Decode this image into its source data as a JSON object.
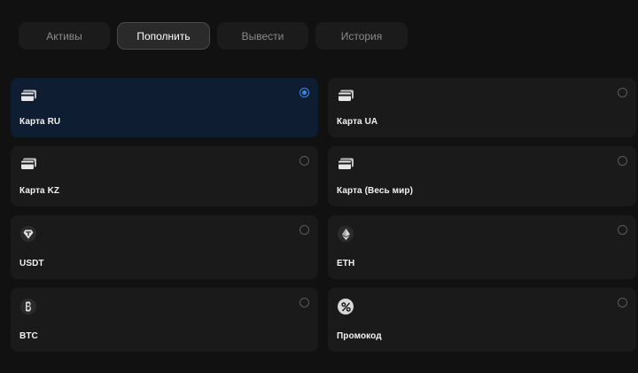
{
  "tabs": [
    {
      "label": "Активы",
      "active": false
    },
    {
      "label": "Пополнить",
      "active": true
    },
    {
      "label": "Вывести",
      "active": false
    },
    {
      "label": "История",
      "active": false
    }
  ],
  "methods": [
    {
      "label": "Карта RU",
      "icon": "card-icon",
      "selected": true
    },
    {
      "label": "Карта UA",
      "icon": "card-icon",
      "selected": false
    },
    {
      "label": "Карта KZ",
      "icon": "card-icon",
      "selected": false
    },
    {
      "label": "Карта (Весь мир)",
      "icon": "card-icon",
      "selected": false
    },
    {
      "label": "USDT",
      "icon": "usdt-icon",
      "selected": false
    },
    {
      "label": "ETH",
      "icon": "eth-icon",
      "selected": false
    },
    {
      "label": "BTC",
      "icon": "btc-icon",
      "selected": false
    },
    {
      "label": "Промокод",
      "icon": "promo-icon",
      "selected": false
    }
  ],
  "colors": {
    "background": "#111111",
    "card": "#1a1a1a",
    "selected_card": "#0f1d33",
    "accent": "#3a86e8"
  }
}
